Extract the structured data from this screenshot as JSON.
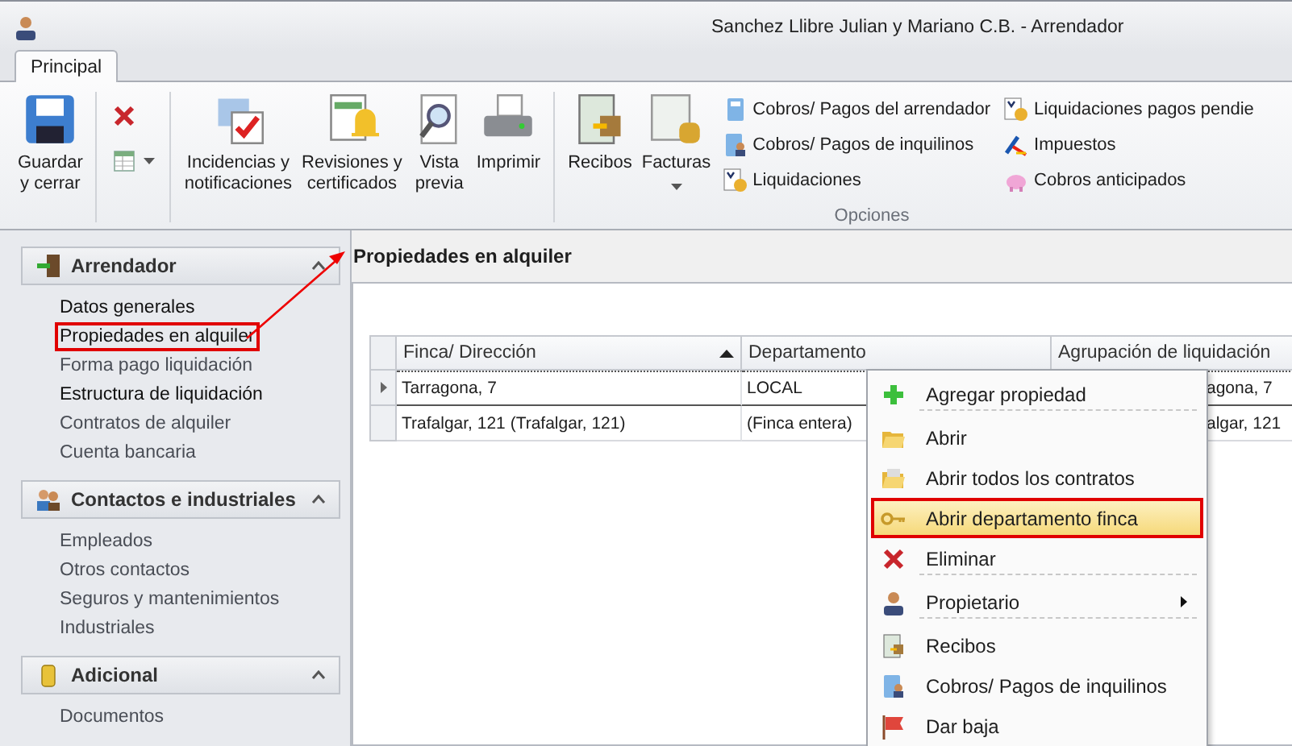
{
  "window": {
    "title": "Sanchez Llibre Julian y Mariano C.B. - Arrendador"
  },
  "tabs": [
    {
      "label": "Principal",
      "selected": true
    }
  ],
  "ribbon": {
    "large_buttons": [
      {
        "label": "Guardar\ny cerrar",
        "dropdown": false
      },
      {
        "kind": "small_stack"
      },
      {
        "label": "Incidencias y\nnotificaciones",
        "dropdown": false
      },
      {
        "label": "Revisiones y\ncertificados",
        "dropdown": false
      },
      {
        "label": "Vista\nprevia",
        "dropdown": false
      },
      {
        "label": "Imprimir",
        "dropdown": false
      },
      {
        "kind": "separator"
      },
      {
        "label": "Recibos",
        "dropdown": false
      },
      {
        "label": "Facturas",
        "dropdown": true
      }
    ],
    "small_stack": [
      {
        "dropdown": false
      },
      {
        "dropdown": true
      }
    ],
    "option_columns": [
      [
        {
          "label": "Cobros/ Pagos del arrendador"
        },
        {
          "label": "Cobros/ Pagos de inquilinos"
        },
        {
          "label": "Liquidaciones"
        }
      ],
      [
        {
          "label": "Liquidaciones pagos pendie"
        },
        {
          "label": "Impuestos"
        },
        {
          "label": "Cobros anticipados"
        }
      ]
    ],
    "group_label": "Opciones"
  },
  "sidebar": [
    {
      "title": "Arrendador",
      "expanded": true,
      "items": [
        {
          "label": "Datos generales",
          "dimmed": false,
          "highlighted": false
        },
        {
          "label": "Propiedades en alquiler",
          "dimmed": false,
          "highlighted": true
        },
        {
          "label": "Forma pago liquidación",
          "dimmed": true,
          "highlighted": false
        },
        {
          "label": "Estructura de liquidación",
          "dimmed": false,
          "highlighted": false
        },
        {
          "label": "Contratos de alquiler",
          "dimmed": true,
          "highlighted": false
        },
        {
          "label": "Cuenta bancaria",
          "dimmed": true,
          "highlighted": false
        }
      ]
    },
    {
      "title": "Contactos e industriales",
      "expanded": true,
      "items": [
        {
          "label": "Empleados",
          "dimmed": true,
          "highlighted": false
        },
        {
          "label": "Otros contactos",
          "dimmed": true,
          "highlighted": false
        },
        {
          "label": "Seguros y mantenimientos",
          "dimmed": true,
          "highlighted": false
        },
        {
          "label": "Industriales",
          "dimmed": true,
          "highlighted": false
        }
      ]
    },
    {
      "title": "Adicional",
      "expanded": true,
      "items": [
        {
          "label": "Documentos",
          "dimmed": true,
          "highlighted": false
        }
      ]
    }
  ],
  "content": {
    "title": "Propiedades en alquiler",
    "table": {
      "columns": [
        {
          "label": "Finca/ Dirección",
          "sorted": true
        },
        {
          "label": "Departamento",
          "sorted": false
        },
        {
          "label": "Agrupación de liquidación",
          "sorted": false
        }
      ],
      "rows": [
        {
          "current": true,
          "cells": [
            "Tarragona, 7",
            "LOCAL",
            "agona, 7"
          ]
        },
        {
          "current": false,
          "cells": [
            "Trafalgar, 121 (Trafalgar, 121)",
            "(Finca entera)",
            "algar, 121"
          ]
        }
      ]
    }
  },
  "context_menu": [
    {
      "label": "Agregar propiedad",
      "highlighted": false,
      "submenu": false,
      "separator_after": true
    },
    {
      "label": "Abrir",
      "highlighted": false,
      "submenu": false,
      "separator_after": false
    },
    {
      "label": "Abrir todos los contratos",
      "highlighted": false,
      "submenu": false,
      "separator_after": false
    },
    {
      "label": "Abrir departamento finca",
      "highlighted": true,
      "submenu": false,
      "separator_after": false
    },
    {
      "label": "Eliminar",
      "highlighted": false,
      "submenu": false,
      "separator_after": true
    },
    {
      "label": "Propietario",
      "highlighted": false,
      "submenu": true,
      "separator_after": true
    },
    {
      "label": "Recibos",
      "highlighted": false,
      "submenu": false,
      "separator_after": false
    },
    {
      "label": "Cobros/ Pagos de inquilinos",
      "highlighted": false,
      "submenu": false,
      "separator_after": false
    },
    {
      "label": "Dar baja",
      "highlighted": false,
      "submenu": false,
      "separator_after": false
    }
  ]
}
